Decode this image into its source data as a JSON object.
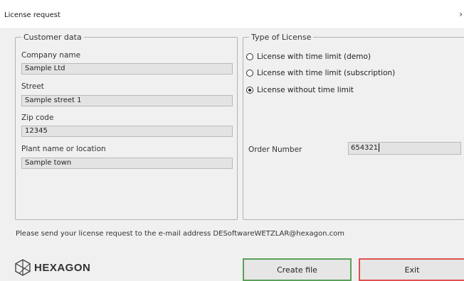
{
  "window": {
    "title": "License request",
    "close_icon": "›"
  },
  "customer": {
    "legend": "Customer data",
    "company_label": "Company name",
    "company_value": "Sample Ltd",
    "street_label": "Street",
    "street_value": "Sample street 1",
    "zip_label": "Zip code",
    "zip_value": "12345",
    "plant_label": "Plant name or location",
    "plant_value": "Sample town"
  },
  "license": {
    "legend": "Type of License",
    "options": [
      {
        "label": "License with time limit (demo)",
        "checked": false
      },
      {
        "label": "License with time limit (subscription)",
        "checked": false
      },
      {
        "label": "License without time limit",
        "checked": true
      }
    ],
    "order_label": "Order Number",
    "order_value": "654321"
  },
  "notice": "Please send your license request to the e-mail address DESoftwareWETZLAR@hexagon.com",
  "logo": {
    "text": "HEXAGON",
    "icon": "hexagon-logo-icon"
  },
  "buttons": {
    "create": "Create file",
    "exit": "Exit"
  },
  "colors": {
    "create_border": "#5ba05b",
    "exit_border": "#e05050"
  }
}
